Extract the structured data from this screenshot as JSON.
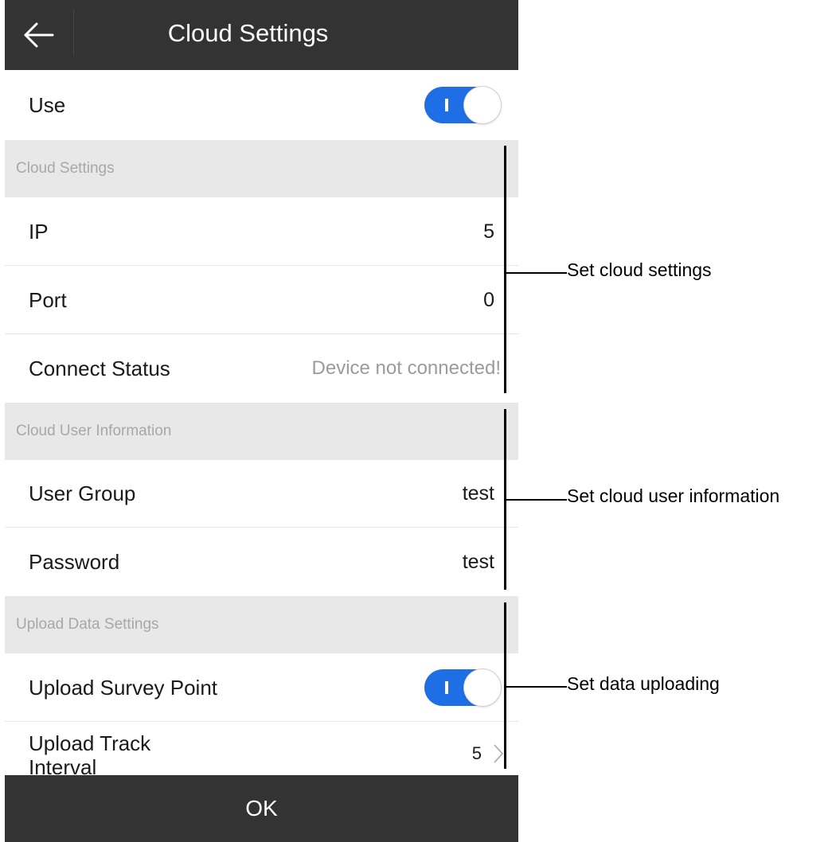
{
  "header": {
    "title": "Cloud Settings",
    "back_icon": "arrow-left-icon"
  },
  "use": {
    "label": "Use",
    "enabled": true
  },
  "cloud_settings": {
    "section_title": "Cloud Settings",
    "ip": {
      "label": "IP",
      "value": "5"
    },
    "port": {
      "label": "Port",
      "value": "0"
    },
    "connect_status": {
      "label": "Connect Status",
      "value": "Device not connected!"
    }
  },
  "cloud_user": {
    "section_title": "Cloud User Information",
    "user_group": {
      "label": "User Group",
      "value": "test"
    },
    "password": {
      "label": "Password",
      "value": "test"
    }
  },
  "upload": {
    "section_title": "Upload Data Settings",
    "survey_point": {
      "label": "Upload Survey Point",
      "enabled": true
    },
    "track_interval": {
      "label": "Upload Track Interval",
      "value": "5",
      "icon": "chevron-right-icon"
    }
  },
  "footer": {
    "ok_label": "OK"
  },
  "annotations": {
    "cloud_settings": "Set cloud settings",
    "cloud_user": "Set cloud user information",
    "upload": "Set data uploading"
  },
  "colors": {
    "header_bg": "#333333",
    "accent": "#1e6fe6",
    "section_bg": "#e8e8e8",
    "muted_text": "#9b9b9b"
  }
}
